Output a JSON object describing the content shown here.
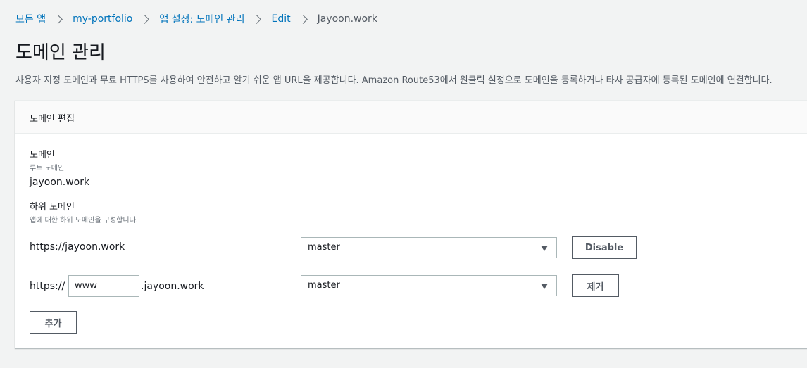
{
  "breadcrumb": {
    "all_apps": "모든 앱",
    "app": "my-portfolio",
    "settings": "앱 설정: 도메인 관리",
    "edit": "Edit",
    "current": "Jayoon.work"
  },
  "page": {
    "title": "도메인 관리",
    "description": "사용자 지정 도메인과 무료 HTTPS를 사용하여 안전하고 알기 쉬운 앱 URL을 제공합니다. Amazon Route53에서 원클릭 설정으로 도메인을 등록하거나 타사 공급자에 등록된 도메인에 연결합니다."
  },
  "panel": {
    "title": "도메인 편집",
    "domain": {
      "label": "도메인",
      "sublabel": "루트 도메인",
      "value": "jayoon.work"
    },
    "subdomains": {
      "label": "하위 도메인",
      "sublabel": "앱에 대한 하위 도메인을 구성합니다.",
      "rows": [
        {
          "url": "https://jayoon.work",
          "branch": "master",
          "button": "Disable"
        },
        {
          "prefix": "https://",
          "input_value": "www",
          "suffix": ".jayoon.work",
          "branch": "master",
          "button": "제거"
        }
      ],
      "add_button": "추가"
    }
  },
  "colors": {
    "link": "#0073bb",
    "page_bg": "#f2f3f3",
    "panel_header_bg": "#fafafa",
    "text": "#16191f",
    "secondary_text": "#545b64",
    "input_border": "#aab7b8"
  },
  "icons": {
    "breadcrumb_separator": "chevron-right-icon",
    "select_caret": "caret-down-icon"
  }
}
